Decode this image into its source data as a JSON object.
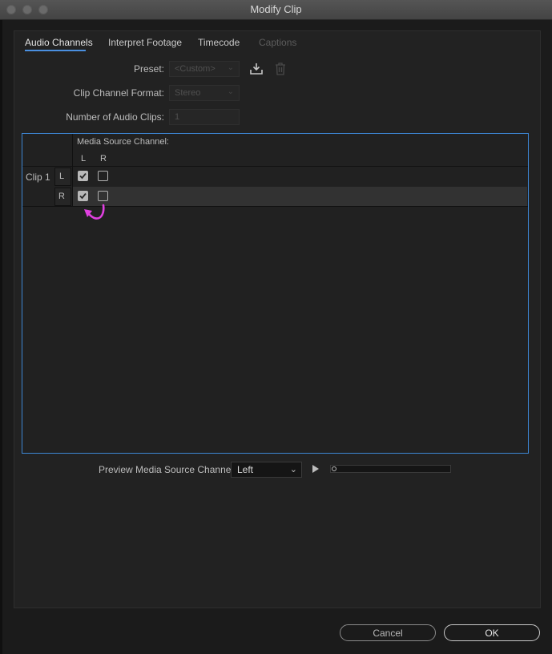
{
  "window": {
    "title": "Modify Clip"
  },
  "tabs": [
    {
      "label": "Audio Channels",
      "state": "active"
    },
    {
      "label": "Interpret Footage",
      "state": "normal"
    },
    {
      "label": "Timecode",
      "state": "normal"
    },
    {
      "label": "Captions",
      "state": "disabled"
    }
  ],
  "form": {
    "preset_label": "Preset:",
    "preset_value": "<Custom>",
    "format_label": "Clip Channel Format:",
    "format_value": "Stereo",
    "num_clips_label": "Number of Audio Clips:",
    "num_clips_value": "1"
  },
  "channel_table": {
    "header": "Media Source Channel:",
    "columns": [
      "L",
      "R"
    ],
    "clip_label": "Clip 1",
    "rows": [
      {
        "channel": "L",
        "L_checked": true,
        "R_checked": false
      },
      {
        "channel": "R",
        "L_checked": true,
        "R_checked": false
      }
    ]
  },
  "preview": {
    "label": "Preview Media Source Channel:",
    "selected": "Left",
    "progress": 0
  },
  "buttons": {
    "cancel": "Cancel",
    "ok": "OK"
  },
  "colors": {
    "accent": "#4a8fe0",
    "annotation_arrow": "#e040e0"
  }
}
